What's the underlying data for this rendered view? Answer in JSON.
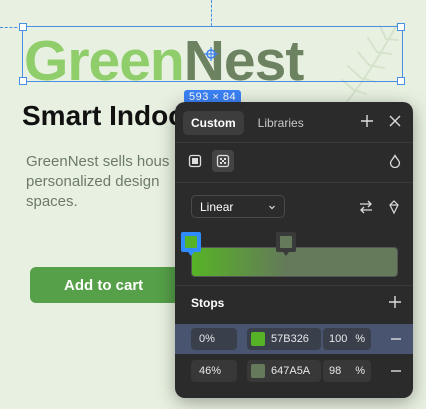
{
  "canvas": {
    "brand_part1": "Green",
    "brand_part2": "Nest",
    "selection_size": "593 × 84",
    "headline": "Smart Indoo",
    "body_lines": [
      "GreenNest sells hous",
      "personalized design",
      "spaces."
    ],
    "cta_label": "Add to cart",
    "brand_color_light": "#8fce6a",
    "brand_color_dark": "#6c8260",
    "cta_color": "#55a048",
    "selection_color": "#3b82f6"
  },
  "panel": {
    "tabs": [
      {
        "label": "Custom",
        "active": true
      },
      {
        "label": "Libraries",
        "active": false
      }
    ],
    "header_icons": [
      "plus-icon",
      "close-icon"
    ],
    "fill_kinds": [
      "solid-fill-icon",
      "gradient-fill-icon",
      "image-fill-icon"
    ],
    "gradient_type": "Linear",
    "gradient_tools": [
      "swap-icon",
      "rotate-icon"
    ],
    "stops_label": "Stops",
    "stops": [
      {
        "position": "0%",
        "hex": "57B326",
        "color": "#57B326",
        "opacity": "100",
        "unit": "%",
        "selected": true
      },
      {
        "position": "46%",
        "hex": "647A5A",
        "color": "#647A5A",
        "opacity": "98",
        "unit": "%",
        "selected": false
      }
    ]
  }
}
